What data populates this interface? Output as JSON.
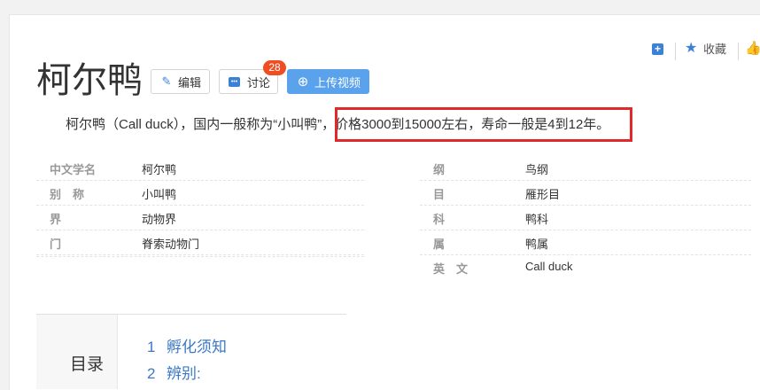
{
  "toolbar": {
    "favorite_label": "收藏"
  },
  "entry": {
    "title": "柯尔鸭",
    "edit_label": "编辑",
    "discuss_label": "讨论",
    "discuss_count": "28",
    "upload_label": "上传视频",
    "summary": "柯尔鸭（Call duck），国内一般称为“小叫鸭”，价格3000到15000左右，寿命一般是4到12年。"
  },
  "info_left": [
    {
      "key": "中文学名",
      "value": "柯尔鸭"
    },
    {
      "key": "别　称",
      "value": "小叫鸭"
    },
    {
      "key": "界",
      "value": "动物界"
    },
    {
      "key": "门",
      "value": "脊索动物门"
    }
  ],
  "info_right": [
    {
      "key": "纲",
      "value": "鸟纲"
    },
    {
      "key": "目",
      "value": "雁形目"
    },
    {
      "key": "科",
      "value": "鸭科"
    },
    {
      "key": "属",
      "value": "鸭属"
    },
    {
      "key": "英　文",
      "value": "Call duck"
    }
  ],
  "toc": {
    "title": "目录",
    "items": [
      {
        "num": "1",
        "label": "孵化须知"
      },
      {
        "num": "2",
        "label": "辨别:"
      }
    ]
  },
  "colors": {
    "accent": "#3b82d6",
    "upload_button": "#5aa2ec",
    "badge": "#f04d22",
    "highlight": "#e0292a"
  }
}
